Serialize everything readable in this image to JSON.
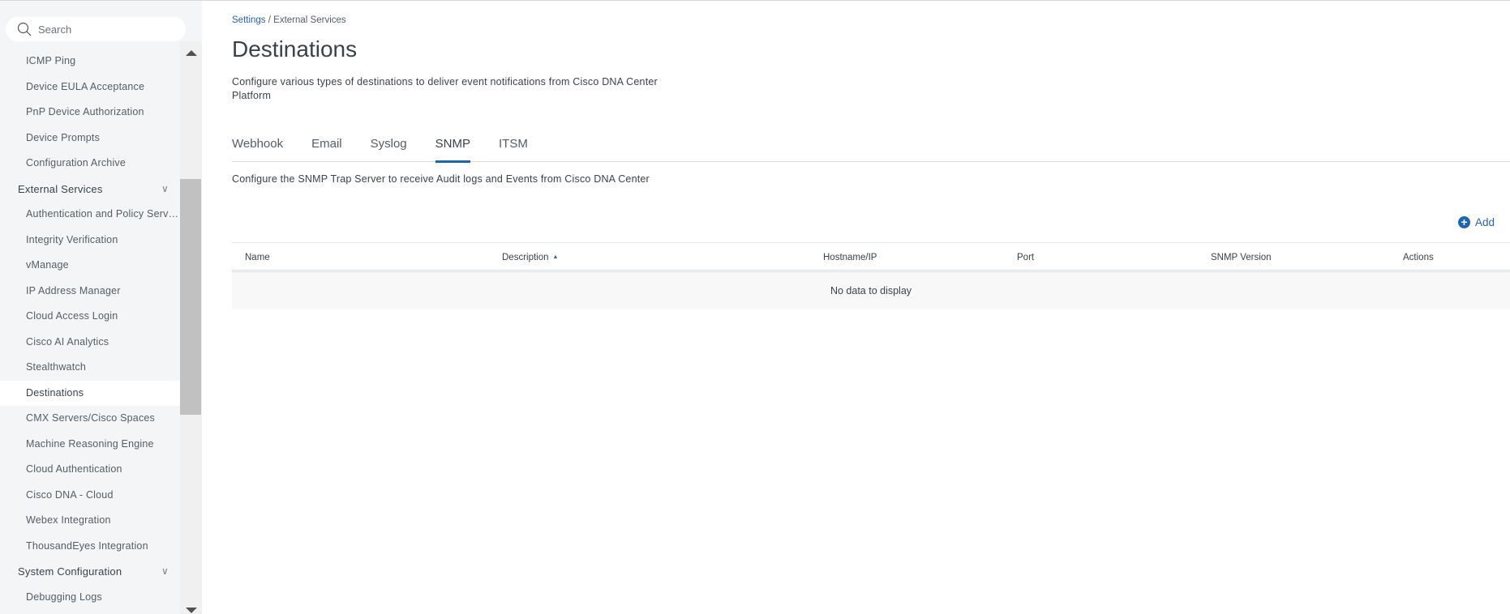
{
  "sidebar": {
    "search_placeholder": "Search",
    "items": [
      {
        "label": "ICMP Ping",
        "type": "item"
      },
      {
        "label": "Device EULA Acceptance",
        "type": "item"
      },
      {
        "label": "PnP Device Authorization",
        "type": "item"
      },
      {
        "label": "Device Prompts",
        "type": "item"
      },
      {
        "label": "Configuration Archive",
        "type": "item"
      },
      {
        "label": "External Services",
        "type": "group"
      },
      {
        "label": "Authentication and Policy Servers",
        "type": "item"
      },
      {
        "label": "Integrity Verification",
        "type": "item"
      },
      {
        "label": "vManage",
        "type": "item"
      },
      {
        "label": "IP Address Manager",
        "type": "item"
      },
      {
        "label": "Cloud Access Login",
        "type": "item"
      },
      {
        "label": "Cisco AI Analytics",
        "type": "item"
      },
      {
        "label": "Stealthwatch",
        "type": "item"
      },
      {
        "label": "Destinations",
        "type": "item",
        "selected": true
      },
      {
        "label": "CMX Servers/Cisco Spaces",
        "type": "item"
      },
      {
        "label": "Machine Reasoning Engine",
        "type": "item"
      },
      {
        "label": "Cloud Authentication",
        "type": "item"
      },
      {
        "label": "Cisco DNA - Cloud",
        "type": "item"
      },
      {
        "label": "Webex Integration",
        "type": "item"
      },
      {
        "label": "ThousandEyes Integration",
        "type": "item"
      },
      {
        "label": "System Configuration",
        "type": "group"
      },
      {
        "label": "Debugging Logs",
        "type": "item"
      }
    ]
  },
  "breadcrumb": {
    "root": "Settings",
    "separator": "/",
    "current": "External Services"
  },
  "page": {
    "title": "Destinations",
    "description": "Configure various types of destinations to deliver event notifications from Cisco DNA Center Platform"
  },
  "tabs": [
    {
      "label": "Webhook"
    },
    {
      "label": "Email"
    },
    {
      "label": "Syslog"
    },
    {
      "label": "SNMP",
      "active": true
    },
    {
      "label": "ITSM"
    }
  ],
  "snmp": {
    "description": "Configure the SNMP Trap Server to receive Audit logs and Events from Cisco DNA Center",
    "add_label": "Add",
    "columns": [
      "Name",
      "Description",
      "Hostname/IP",
      "Port",
      "SNMP Version",
      "Actions"
    ],
    "empty_text": "No data to display"
  },
  "colors": {
    "accent": "#1f64b3",
    "link": "#2b5fa8",
    "sidebar_bg": "#f4f5f6"
  }
}
